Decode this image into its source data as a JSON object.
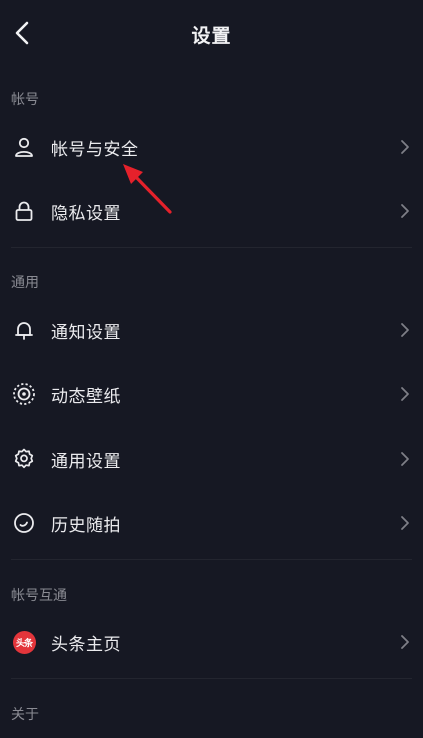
{
  "header": {
    "title": "设置",
    "back_icon": "chevron-left-icon"
  },
  "sections": {
    "account": {
      "label": "帐号"
    },
    "general": {
      "label": "通用"
    },
    "linked": {
      "label": "帐号互通"
    },
    "about": {
      "label": "关于"
    }
  },
  "items": {
    "account_security": {
      "label": "帐号与安全",
      "icon": "user-icon"
    },
    "privacy": {
      "label": "隐私设置",
      "icon": "lock-icon"
    },
    "notifications": {
      "label": "通知设置",
      "icon": "bell-icon"
    },
    "wallpaper": {
      "label": "动态壁纸",
      "icon": "wallpaper-icon"
    },
    "general_settings": {
      "label": "通用设置",
      "icon": "gear-icon"
    },
    "history": {
      "label": "历史随拍",
      "icon": "history-icon"
    },
    "toutiao": {
      "label": "头条主页",
      "icon": "toutiao-logo-icon",
      "badge": "头条"
    }
  },
  "colors": {
    "background": "#161823",
    "text": "#ebebee",
    "section_text": "#8a8b93",
    "annotation": "#e5212b"
  }
}
